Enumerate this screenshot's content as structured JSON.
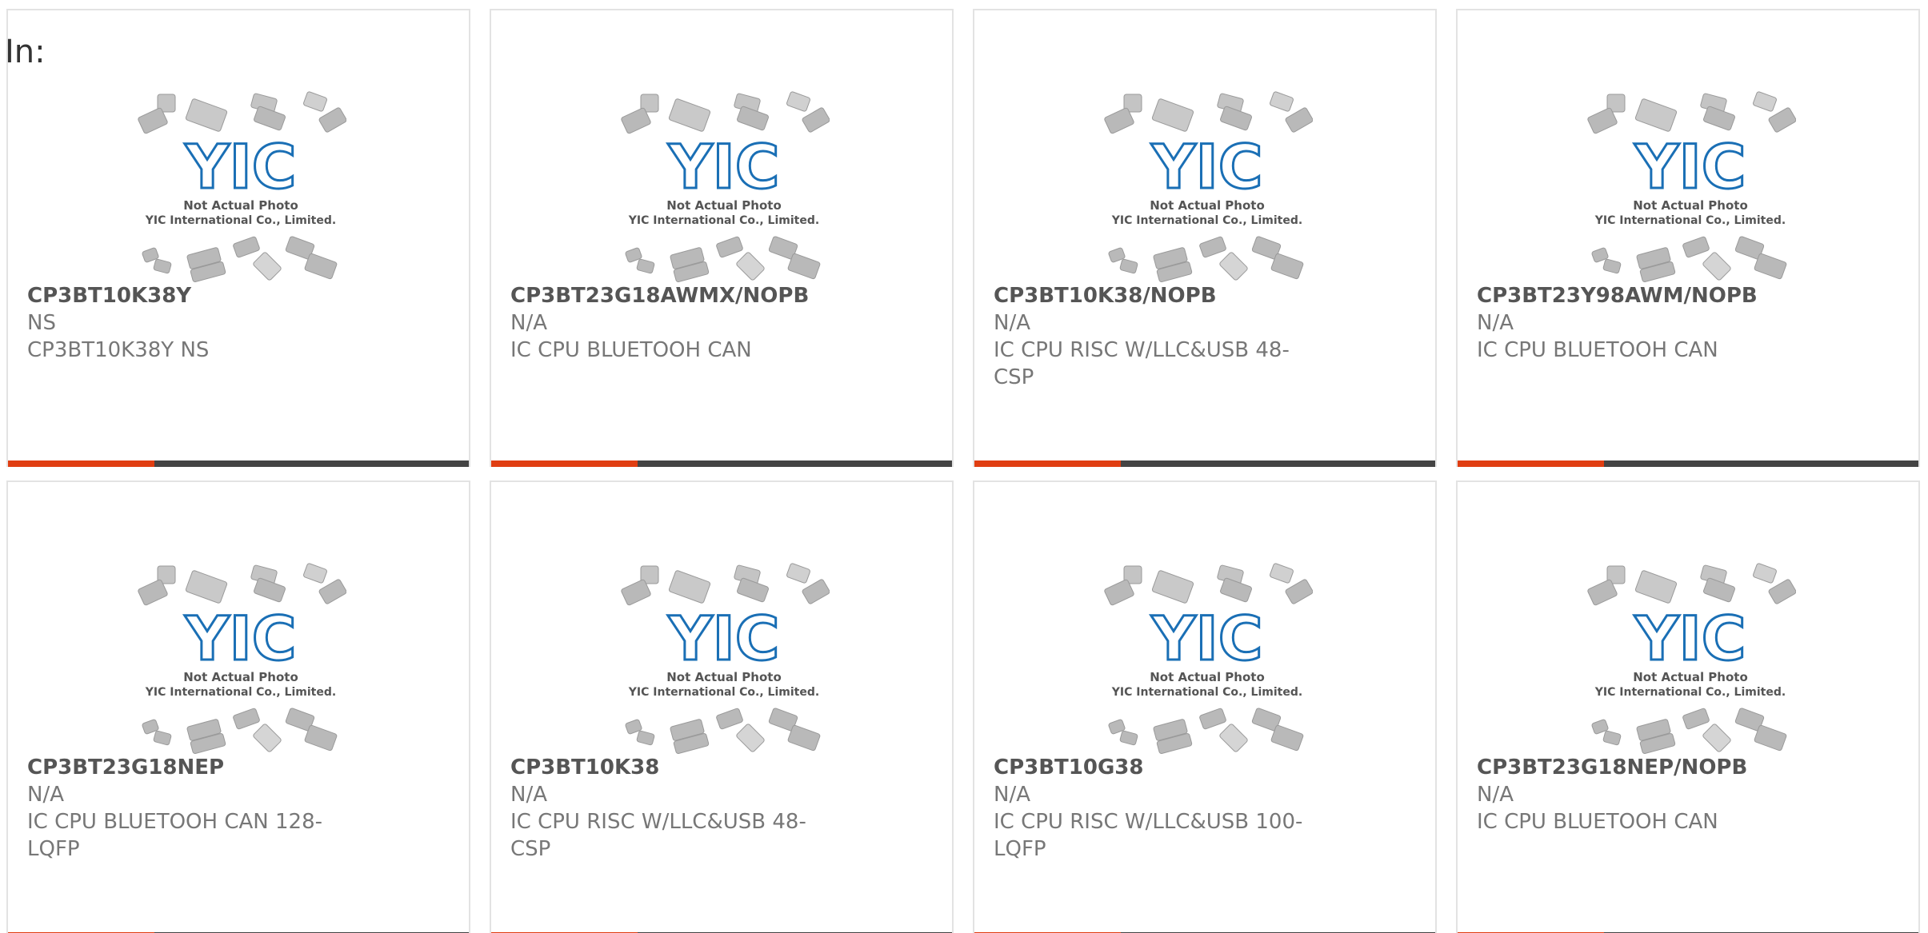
{
  "heading": {
    "label": "In:"
  },
  "placeholder": {
    "line1": "Not Actual Photo",
    "line2": "YIC International Co., Limited.",
    "logo_text": "YIC"
  },
  "colors": {
    "accent": "#e03e12",
    "bar": "#444444",
    "logo": "#1a6fb5"
  },
  "products": [
    {
      "part": "CP3BT10K38Y",
      "mfr": "NS",
      "desc": "CP3BT10K38Y NS"
    },
    {
      "part": "CP3BT23G18AWMX/NOPB",
      "mfr": "N/A",
      "desc": "IC CPU BLUETOOH CAN"
    },
    {
      "part": "CP3BT10K38/NOPB",
      "mfr": "N/A",
      "desc": "IC CPU RISC W/LLC&USB 48-CSP"
    },
    {
      "part": "CP3BT23Y98AWM/NOPB",
      "mfr": "N/A",
      "desc": "IC CPU BLUETOOH CAN"
    },
    {
      "part": "CP3BT23G18NEP",
      "mfr": "N/A",
      "desc": "IC CPU BLUETOOH CAN 128-LQFP"
    },
    {
      "part": "CP3BT10K38",
      "mfr": "N/A",
      "desc": "IC CPU RISC W/LLC&USB 48-CSP"
    },
    {
      "part": "CP3BT10G38",
      "mfr": "N/A",
      "desc": "IC CPU RISC W/LLC&USB 100-LQFP"
    },
    {
      "part": "CP3BT23G18NEP/NOPB",
      "mfr": "N/A",
      "desc": "IC CPU BLUETOOH CAN"
    }
  ]
}
